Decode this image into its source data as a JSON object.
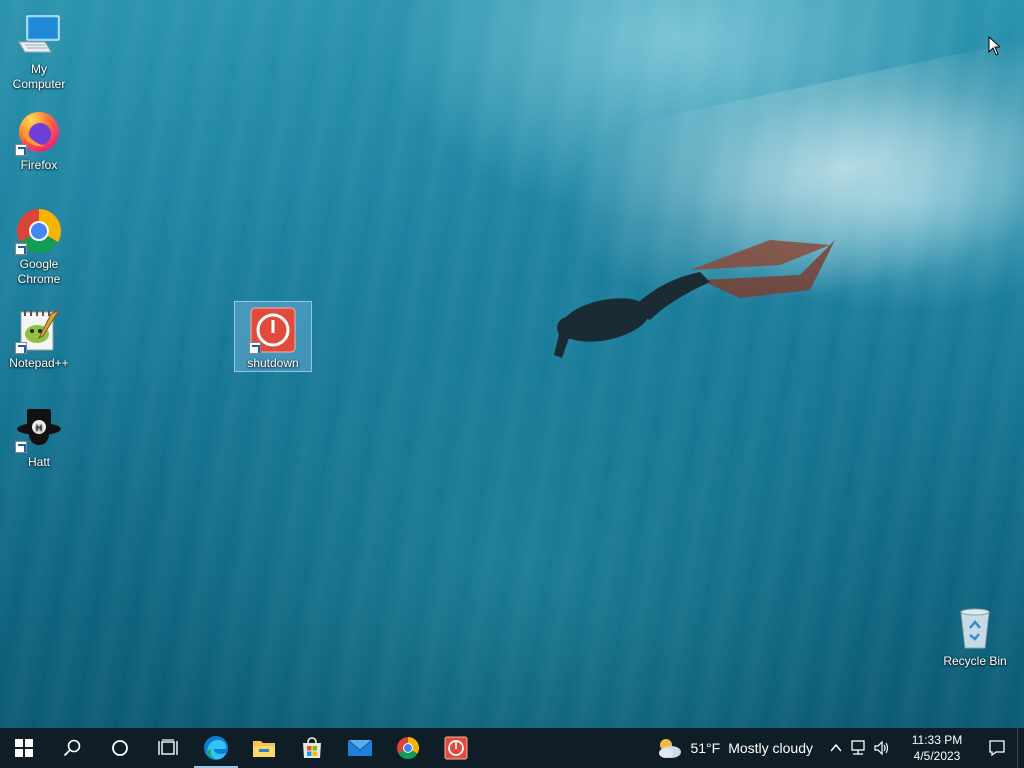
{
  "desktop": {
    "icons": [
      {
        "label": "My Computer"
      },
      {
        "label": "Firefox"
      },
      {
        "label": "Google Chrome"
      },
      {
        "label": "Notepad++"
      },
      {
        "label": "Hatt"
      },
      {
        "label": "shutdown"
      },
      {
        "label": "Recycle Bin"
      }
    ]
  },
  "taskbar": {
    "pinned": [
      "windows-start",
      "search",
      "cortana",
      "task-view",
      "edge",
      "file-explorer",
      "microsoft-store",
      "mail",
      "chrome",
      "shutdown"
    ],
    "weather": {
      "temp": "51°F",
      "condition": "Mostly cloudy",
      "icon": "partly-cloudy-icon"
    },
    "clock": {
      "time": "11:33 PM",
      "date": "4/5/2023"
    }
  },
  "colors": {
    "taskbar_bg": "#0f1e26",
    "accent": "#9cc7e8",
    "selection": "#a0d2ff"
  }
}
